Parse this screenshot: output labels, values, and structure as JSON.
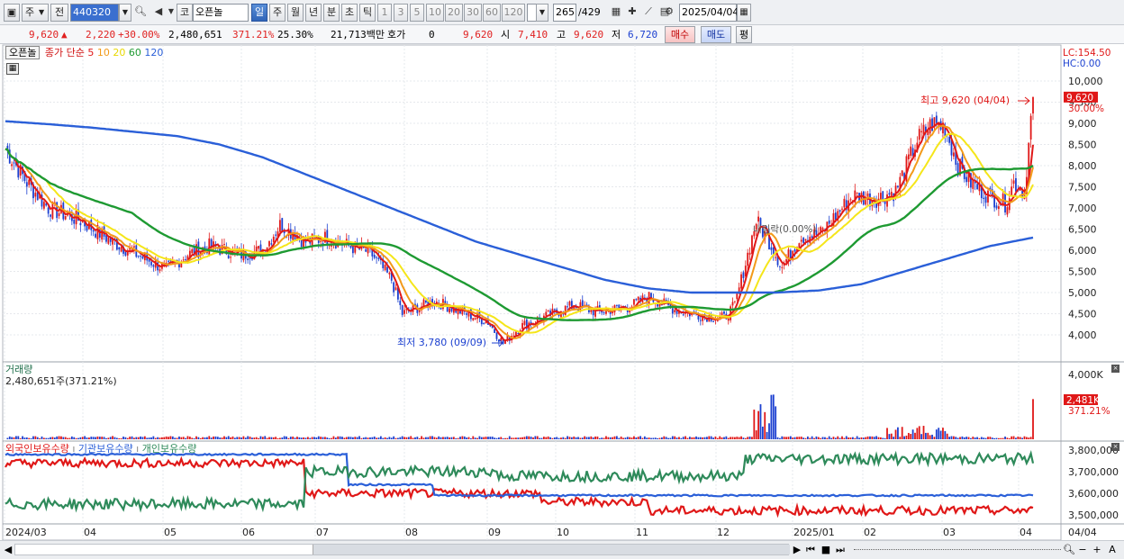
{
  "toolbar": {
    "market_label": "주",
    "all_label": "전",
    "code": "440320",
    "exchange_label": "코",
    "stock_name": "오픈놀",
    "periods": [
      "일",
      "주",
      "월",
      "년",
      "분",
      "초",
      "틱"
    ],
    "selected_period": "일",
    "intervals": [
      "1",
      "3",
      "5",
      "10",
      "20",
      "30",
      "60",
      "120"
    ],
    "count": "265",
    "total": "/429",
    "date": "2025/04/04"
  },
  "quote": {
    "price": "9,620",
    "change": "2,220",
    "change_pct": "+30.00%",
    "volume": "2,480,651",
    "vol_ratio": "371.21%",
    "turnover": "25.30%",
    "amount": "21,713백만",
    "hoga_label": "호가",
    "hoga_value": "0",
    "hoga_price": "9,620",
    "open_label": "시",
    "open": "7,410",
    "high_label": "고",
    "high": "9,620",
    "low_label": "저",
    "low": "6,720",
    "buy_label": "매수",
    "sell_label": "매도",
    "flat_label": "평"
  },
  "price_panel": {
    "name_tag": "오픈놀",
    "ma_title": "종가 단순",
    "ma_periods": [
      "5",
      "10",
      "20",
      "60",
      "120"
    ],
    "ma_colors": [
      "#e01818",
      "#f29a1a",
      "#f5e61a",
      "#1e9a32",
      "#2a5fd8"
    ],
    "lc": "LC:154.50",
    "hc": "HC:0.00",
    "y_ticks": [
      "10,000",
      "9,500",
      "9,000",
      "8,500",
      "8,000",
      "7,500",
      "7,000",
      "6,500",
      "6,000",
      "5,500",
      "5,000",
      "4,500",
      "4,000"
    ],
    "price_tag": "9,620",
    "pct_tag": "30.00%",
    "high_note": "최고 9,620 (04/04)",
    "low_note": "최저 3,780 (09/09)",
    "mid_note": "내림락(0.00%)"
  },
  "volume_panel": {
    "title": "거래량",
    "value": "2,480,651주(371.21%)",
    "y_tick": "4,000K",
    "tag": "2,481K",
    "tag_pct": "371.21%"
  },
  "holdings_panel": {
    "series": [
      "외국인보유수량",
      "기관보유수량",
      "개인보유수량"
    ],
    "series_colors": [
      "#e01818",
      "#2a5fd8",
      "#2e8a5a"
    ],
    "y_ticks": [
      "3,800,000",
      "3,700,000",
      "3,600,000",
      "3,500,000"
    ]
  },
  "x_axis": {
    "labels": [
      "2024/03",
      "04",
      "05",
      "06",
      "07",
      "08",
      "09",
      "10",
      "11",
      "12",
      "2025/01",
      "02",
      "03",
      "04",
      "04/04"
    ]
  }
}
